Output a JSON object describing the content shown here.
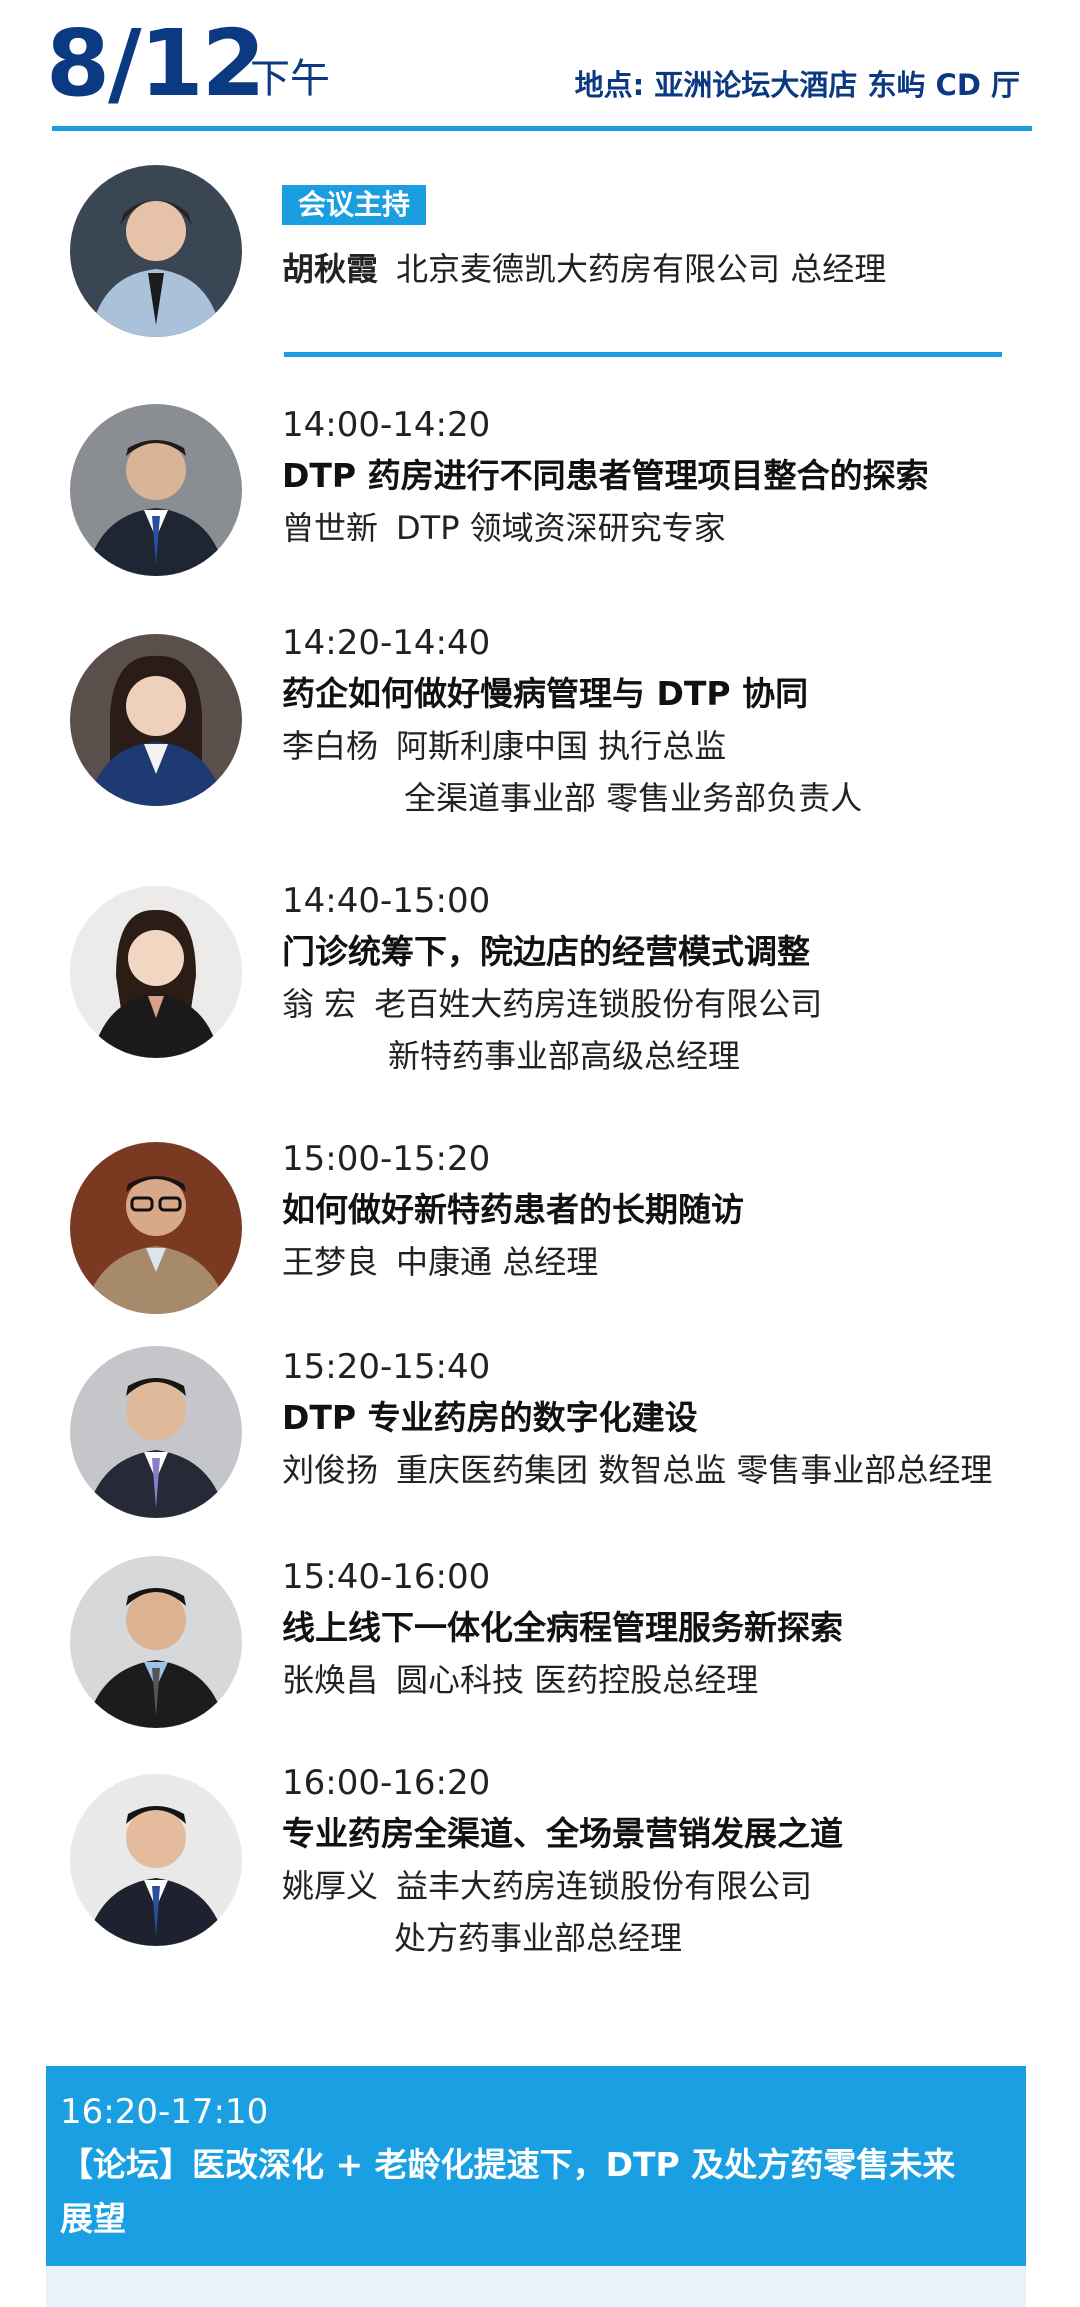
{
  "header": {
    "date": "8/12",
    "ampm": "下午",
    "venue": "地点: 亚洲论坛大酒店  东屿 CD 厅"
  },
  "host": {
    "badge": "会议主持",
    "name": "胡秋霞",
    "org": "北京麦德凯大药房有限公司 总经理"
  },
  "sessions": [
    {
      "time": "14:00-14:20",
      "title": "DTP 药房进行不同患者管理项目整合的探索",
      "name": "曾世新",
      "line1": "DTP 领域资深研究专家",
      "line2": ""
    },
    {
      "time": "14:20-14:40",
      "title": "药企如何做好慢病管理与 DTP 协同",
      "name": "李白杨",
      "line1": "阿斯利康中国 执行总监",
      "line2": "全渠道事业部 零售业务部负责人"
    },
    {
      "time": "14:40-15:00",
      "title": "门诊统筹下，院边店的经营模式调整",
      "name": "翁  宏",
      "line1": "老百姓大药房连锁股份有限公司",
      "line2": "新特药事业部高级总经理"
    },
    {
      "time": "15:00-15:20",
      "title": "如何做好新特药患者的长期随访",
      "name": "王梦良",
      "line1": "中康通 总经理",
      "line2": ""
    },
    {
      "time": "15:20-15:40",
      "title": "DTP 专业药房的数字化建设",
      "name": "刘俊扬",
      "line1": "重庆医药集团 数智总监 零售事业部总经理",
      "line2": ""
    },
    {
      "time": "15:40-16:00",
      "title": "线上线下一体化全病程管理服务新探索",
      "name": "张焕昌",
      "line1": "圆心科技 医药控股总经理",
      "line2": ""
    },
    {
      "time": "16:00-16:20",
      "title": "专业药房全渠道、全场景营销发展之道",
      "name": "姚厚义",
      "line1": "益丰大药房连锁股份有限公司",
      "line2": "处方药事业部总经理"
    }
  ],
  "forum": {
    "time": "16:20-17:10",
    "title": "【论坛】医改深化 + 老龄化提速下，DTP 及处方药零售未来展望"
  },
  "colors": {
    "navy": "#0b3a82",
    "accent": "#1a9ee0"
  }
}
